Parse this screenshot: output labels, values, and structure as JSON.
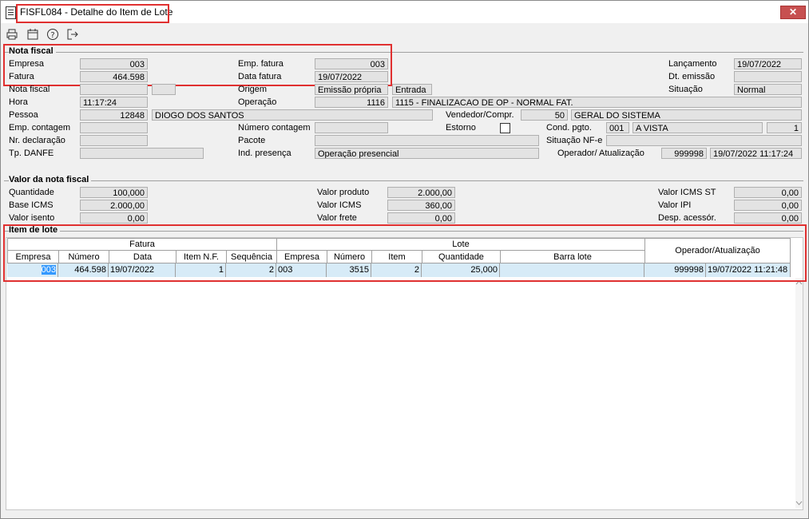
{
  "window": {
    "title": "FISFL084 - Detalhe do Item de Lote"
  },
  "nota_fiscal": {
    "group": "Nota fiscal",
    "empresa_lbl": "Empresa",
    "empresa": "003",
    "fatura_lbl": "Fatura",
    "fatura": "464.598",
    "emp_fatura_lbl": "Emp. fatura",
    "emp_fatura": "003",
    "data_fatura_lbl": "Data fatura",
    "data_fatura": "19/07/2022",
    "lancamento_lbl": "Lançamento",
    "lancamento": "19/07/2022",
    "dt_emissao_lbl": "Dt. emissão",
    "dt_emissao": "",
    "nota_fiscal_lbl": "Nota fiscal",
    "nota_fiscal": "",
    "serie": "",
    "origem_lbl": "Origem",
    "origem": "Emissão própria",
    "tipo": "Entrada",
    "situacao_lbl": "Situação",
    "situacao": "Normal",
    "hora_lbl": "Hora",
    "hora": "11:17:24",
    "operacao_lbl": "Operação",
    "operacao_cod": "1116",
    "operacao_desc": "1115 - FINALIZACAO DE OP - NORMAL FAT.",
    "pessoa_lbl": "Pessoa",
    "pessoa_cod": "12848",
    "pessoa_nome": "DIOGO DOS SANTOS",
    "vendedor_lbl": "Vendedor/Compr.",
    "vendedor_cod": "50",
    "vendedor_nome": "GERAL DO SISTEMA",
    "emp_contagem_lbl": "Emp. contagem",
    "emp_contagem": "",
    "numero_contagem_lbl": "Número contagem",
    "numero_contagem": "",
    "estorno_lbl": "Estorno",
    "cond_pgto_lbl": "Cond. pgto.",
    "cond_pgto_cod": "001",
    "cond_pgto_desc": "A VISTA",
    "cond_pgto_parcelas": "1",
    "nr_declaracao_lbl": "Nr. declaração",
    "nr_declaracao": "",
    "pacote_lbl": "Pacote",
    "pacote": "",
    "situacao_nfe_lbl": "Situação NF-e",
    "situacao_nfe": "",
    "tp_danfe_lbl": "Tp. DANFE",
    "tp_danfe": "",
    "ind_presenca_lbl": "Ind. presença",
    "ind_presenca": "Operação presencial",
    "operador_lbl": "Operador/ Atualização",
    "operador": "999998",
    "atualizacao": "19/07/2022 11:17:24"
  },
  "valor_nf": {
    "group": "Valor da nota fiscal",
    "quantidade_lbl": "Quantidade",
    "quantidade": "100,000",
    "base_icms_lbl": "Base ICMS",
    "base_icms": "2.000,00",
    "valor_isento_lbl": "Valor isento",
    "valor_isento": "0,00",
    "valor_produto_lbl": "Valor produto",
    "valor_produto": "2.000,00",
    "valor_icms_lbl": "Valor ICMS",
    "valor_icms": "360,00",
    "valor_frete_lbl": "Valor frete",
    "valor_frete": "0,00",
    "valor_icms_st_lbl": "Valor ICMS ST",
    "valor_icms_st": "0,00",
    "valor_ipi_lbl": "Valor IPI",
    "valor_ipi": "0,00",
    "desp_acessor_lbl": "Desp. acessór.",
    "desp_acessor": "0,00"
  },
  "item_lote": {
    "group": "Item de lote",
    "fatura_group": "Fatura",
    "lote_group": "Lote",
    "operador_col": "Operador/Atualização",
    "cols": [
      "Empresa",
      "Número",
      "Data",
      "Item N.F.",
      "Sequência",
      "Empresa",
      "Número",
      "Item",
      "Quantidade",
      "Barra lote"
    ],
    "row": [
      "003",
      "464.598",
      "19/07/2022",
      "1",
      "2",
      "003",
      "3515",
      "2",
      "25,000",
      "",
      "999998",
      "19/07/2022 11:21:48"
    ]
  },
  "colors": {
    "highlight": "#e03030",
    "row_bg": "#d7ebf7"
  }
}
